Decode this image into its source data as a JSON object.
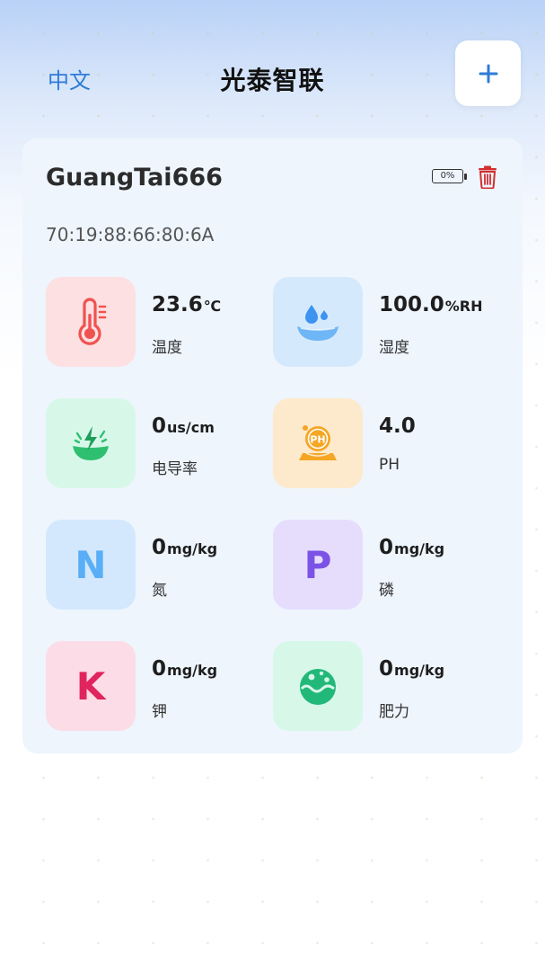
{
  "header": {
    "language": "中文",
    "title": "光泰智联",
    "add_label": "+"
  },
  "device": {
    "name": "GuangTai666",
    "mac": "70:19:88:66:80:6A",
    "battery": "0%"
  },
  "metrics": [
    {
      "value": "23.6",
      "unit": "℃",
      "label": "温度",
      "icon": "thermometer-icon",
      "bg": "#fde0e2",
      "color": "#ef5350"
    },
    {
      "value": "100.0",
      "unit": "%RH",
      "label": "湿度",
      "icon": "water-drop-icon",
      "bg": "#d5e9fd",
      "color": "#42a5f5"
    },
    {
      "value": "0",
      "unit": "us/cm",
      "label": "电导率",
      "icon": "conductivity-icon",
      "bg": "#d7f8e9",
      "color": "#2fbf71"
    },
    {
      "value": "4.0",
      "unit": "",
      "label": "PH",
      "icon": "ph-icon",
      "bg": "#fde9cc",
      "color": "#f5a623"
    },
    {
      "value": "0",
      "unit": "mg/kg",
      "label": "氮",
      "icon": "nitrogen-icon",
      "letter": "N",
      "bg": "#d3e8fd",
      "color": "#5aaef7"
    },
    {
      "value": "0",
      "unit": "mg/kg",
      "label": "磷",
      "icon": "phosphorus-icon",
      "letter": "P",
      "bg": "#e6ddfd",
      "color": "#7b52e6"
    },
    {
      "value": "0",
      "unit": "mg/kg",
      "label": "钾",
      "icon": "potassium-icon",
      "letter": "K",
      "bg": "#fcdce6",
      "color": "#e0245e"
    },
    {
      "value": "0",
      "unit": "mg/kg",
      "label": "肥力",
      "icon": "fertility-icon",
      "bg": "#d7f8e9",
      "color": "#22b87a"
    }
  ]
}
